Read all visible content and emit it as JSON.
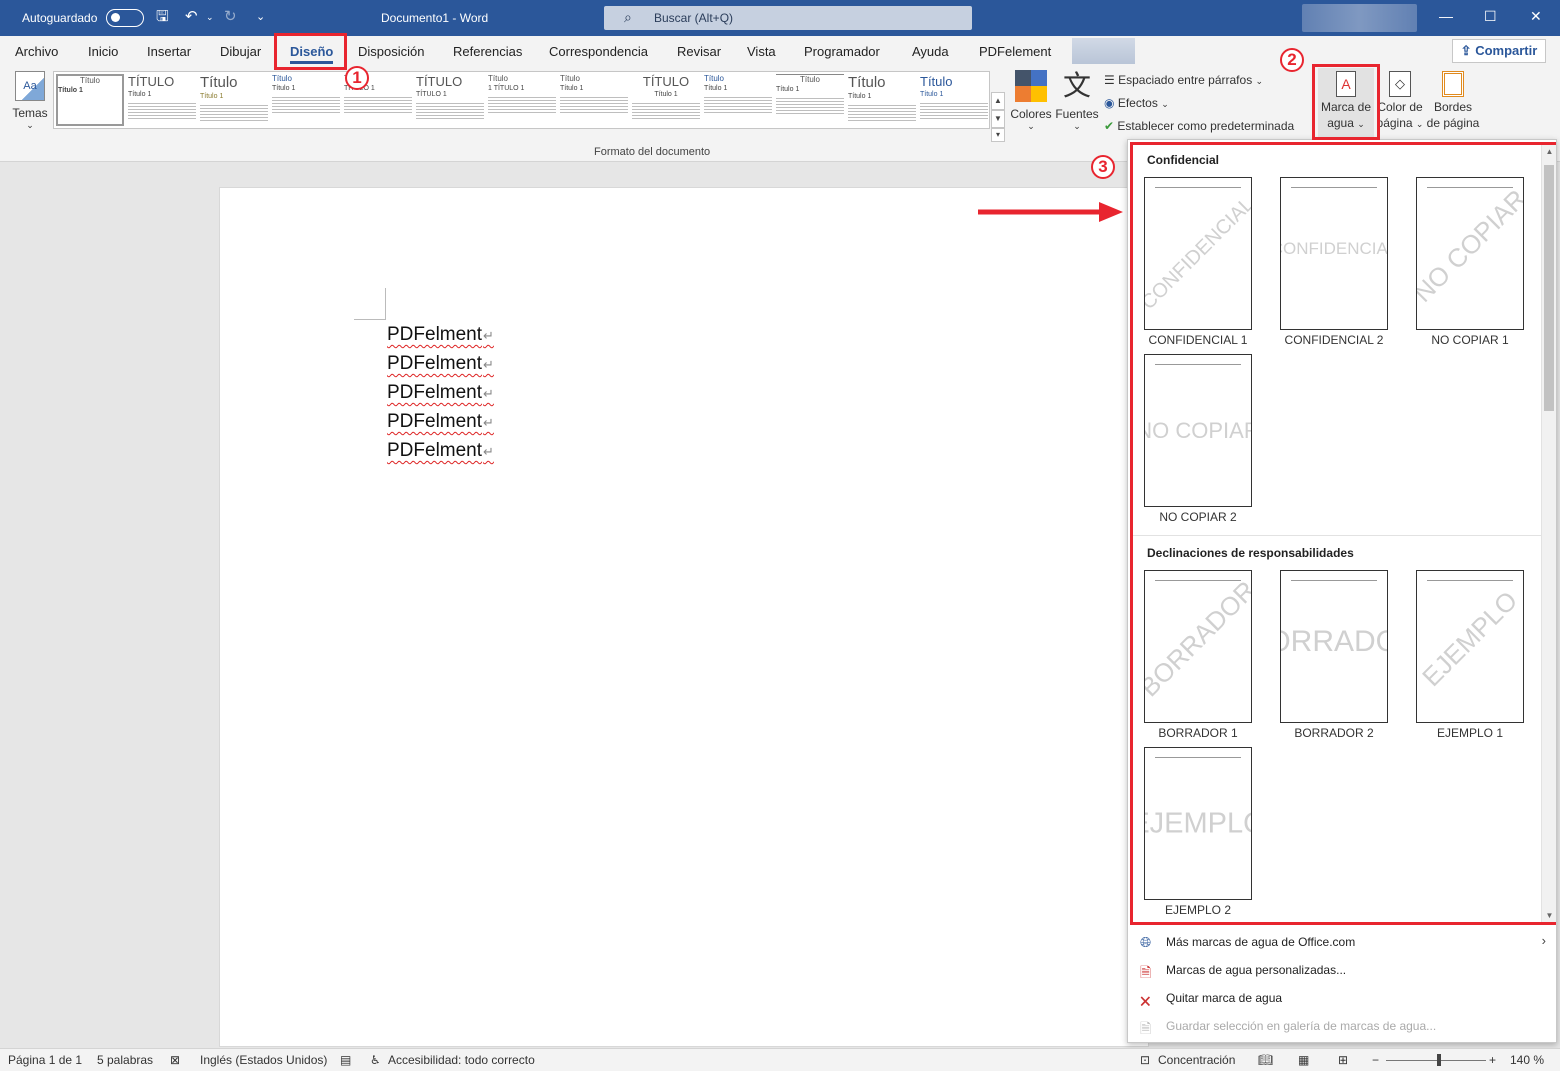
{
  "titlebar": {
    "autosave_label": "Autoguardado",
    "doc_title": "Documento1  -  Word",
    "search_placeholder": "Buscar (Alt+Q)",
    "icons": [
      "save-icon",
      "undo-icon",
      "redo-icon",
      "customize-icon",
      "search-icon",
      "minimize-icon",
      "maximize-icon",
      "close-icon"
    ]
  },
  "menu": {
    "tabs": [
      "Archivo",
      "Inicio",
      "Insertar",
      "Dibujar",
      "Diseño",
      "Disposición",
      "Referencias",
      "Correspondencia",
      "Revisar",
      "Vista",
      "Programador",
      "Ayuda",
      "PDFelement"
    ],
    "active_tab": "Diseño",
    "share_label": "Compartir"
  },
  "ribbon": {
    "temas_label": "Temas",
    "gallery": [
      {
        "title": "Título",
        "sub": "Título 1"
      },
      {
        "title": "TÍTULO",
        "sub": "Título 1"
      },
      {
        "title": "Título",
        "sub": "Título 1"
      },
      {
        "title": "Título",
        "sub": "Título 1"
      },
      {
        "title": "Título",
        "sub": "TÍTULO 1"
      },
      {
        "title": "TÍTULO",
        "sub": "TÍTULO 1"
      },
      {
        "title": "Título",
        "sub": "1  TÍTULO 1"
      },
      {
        "title": "Título",
        "sub": "Título 1"
      },
      {
        "title": "TÍTULO",
        "sub": "Título 1"
      },
      {
        "title": "Título",
        "sub": "Título 1"
      },
      {
        "title": "Título",
        "sub": "Título 1"
      },
      {
        "title": "Título",
        "sub": "Título 1"
      },
      {
        "title": "Título",
        "sub": "Título 1"
      }
    ],
    "colores_label": "Colores",
    "fuentes_label": "Fuentes",
    "espaciado_label": "Espaciado entre párrafos",
    "efectos_label": "Efectos",
    "predeterminada_label": "Establecer como predeterminada",
    "marca_agua_label_1": "Marca de",
    "marca_agua_label_2": "agua",
    "color_pagina_label_1": "Color de",
    "color_pagina_label_2": "página",
    "bordes_label_1": "Bordes",
    "bordes_label_2": "de página",
    "group_label": "Formato del documento",
    "colors": {
      "accent": "#2b579a",
      "highlight": "#e8252f"
    }
  },
  "document": {
    "lines": [
      "PDFelment",
      "PDFelment",
      "PDFelment",
      "PDFelment",
      "PDFelment"
    ],
    "para_mark": "↵"
  },
  "watermark_dropdown": {
    "sections": [
      {
        "header": "Confidencial",
        "items": [
          {
            "label": "CONFIDENCIAL 1",
            "text": "CONFIDENCIAL",
            "style": "diagonal"
          },
          {
            "label": "CONFIDENCIAL 2",
            "text": "CONFIDENCIAL",
            "style": "horizontal"
          },
          {
            "label": "NO COPIAR 1",
            "text": "NO COPIAR",
            "style": "diagonal"
          },
          {
            "label": "NO COPIAR 2",
            "text": "NO COPIAR",
            "style": "horizontal"
          }
        ]
      },
      {
        "header": "Declinaciones de responsabilidades",
        "items": [
          {
            "label": "BORRADOR 1",
            "text": "BORRADOR",
            "style": "diagonal"
          },
          {
            "label": "BORRADOR 2",
            "text": "BORRADOR",
            "style": "horizontal"
          },
          {
            "label": "EJEMPLO 1",
            "text": "EJEMPLO",
            "style": "diagonal"
          },
          {
            "label": "EJEMPLO 2",
            "text": "EJEMPLO",
            "style": "horizontal"
          }
        ]
      }
    ],
    "menu_items": [
      {
        "label": "Más marcas de agua de Office.com",
        "icon": "globe-icon",
        "enabled": true,
        "submenu": true
      },
      {
        "label": "Marcas de agua personalizadas...",
        "icon": "custom-watermark-icon",
        "enabled": true
      },
      {
        "label": "Quitar marca de agua",
        "icon": "remove-watermark-icon",
        "enabled": true
      },
      {
        "label": "Guardar selección en galería de marcas de agua...",
        "icon": "save-gallery-icon",
        "enabled": false
      }
    ]
  },
  "annotations": {
    "badges": [
      "1",
      "2",
      "3"
    ]
  },
  "statusbar": {
    "page": "Página 1 de 1",
    "words": "5 palabras",
    "language": "Inglés (Estados Unidos)",
    "accessibility": "Accesibilidad: todo correcto",
    "focus": "Concentración",
    "zoom_minus": "−",
    "zoom_plus": "+",
    "zoom": "140 %"
  }
}
